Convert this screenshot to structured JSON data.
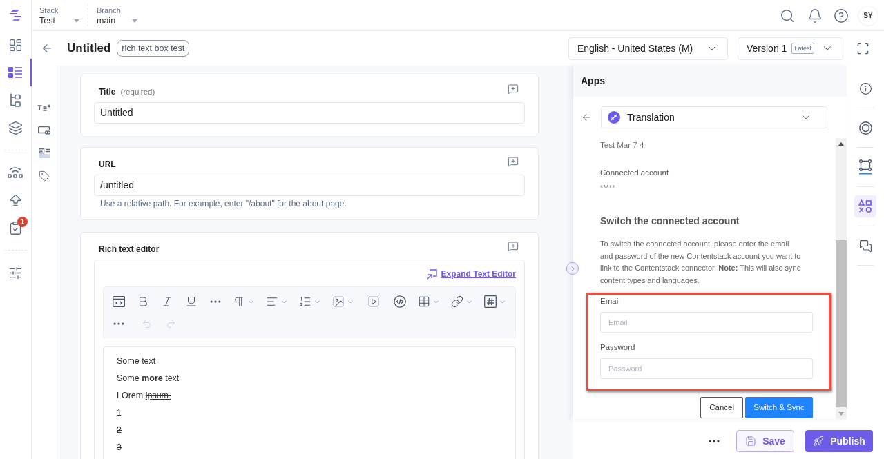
{
  "header": {
    "stack": {
      "label": "Stack",
      "value": "Test"
    },
    "branch": {
      "label": "Branch",
      "value": "main"
    },
    "avatar": "SY"
  },
  "nav_rail": {
    "items": [
      {
        "selected": false
      },
      {
        "selected": true
      },
      {
        "selected": false
      },
      {
        "selected": false
      },
      {
        "selected": false
      },
      {
        "selected": false
      },
      {
        "selected": false,
        "badge": "1"
      },
      {
        "selected": false
      }
    ]
  },
  "entry_bar": {
    "title": "Untitled",
    "tag": "rich text box test",
    "locale": "English - United States (M)",
    "version": "Version 1",
    "version_badge": "Latest"
  },
  "fields": [
    {
      "kind": "text",
      "label": "Title",
      "note": "(required)",
      "value": "Untitled"
    },
    {
      "kind": "text",
      "label": "URL",
      "value": "/untitled",
      "help": "Use a relative path. For example, enter \"/about\" for the about page."
    },
    {
      "kind": "rich_text",
      "label": "Rich text editor",
      "expand_link": "Expand Text Editor",
      "toolbar": {
        "undo_disabled": true,
        "redo_disabled": true
      },
      "paragraphs": [
        {
          "runs": [
            {
              "text": "Some text",
              "strike": false,
              "underline": false
            }
          ]
        },
        {
          "runs": [
            {
              "text": "Some **more** text",
              "strike": false,
              "underline": false
            }
          ]
        },
        {
          "runs": [
            {
              "text": "LOrem ",
              "strike": false,
              "underline": false
            },
            {
              "text": "ipsum ",
              "strike": true,
              "underline": true
            }
          ]
        },
        {
          "runs": [
            {
              "text": "1",
              "strike": true,
              "underline": false
            }
          ]
        },
        {
          "runs": [
            {
              "text": "2",
              "strike": true,
              "underline": false
            }
          ]
        },
        {
          "runs": [
            {
              "text": "3",
              "strike": true,
              "underline": false
            }
          ]
        }
      ]
    }
  ],
  "apps_panel": {
    "title": "Apps",
    "app": "Translation",
    "account_name": "Test Mar 7 4",
    "connected_label": "Connected account",
    "connected_value": "*****",
    "heading": "Switch the connected account",
    "description": "To switch the connected account, please enter the email and password of the new Contentstack account you want to link to the Contentstack connector. **Note:** This will also sync content types and languages.",
    "credentials": {
      "highlighted": true,
      "fields": [
        {
          "label": "Email",
          "placeholder": "Email"
        },
        {
          "label": "Password",
          "placeholder": "Password"
        }
      ]
    },
    "buttons": [
      {
        "kind": "secondary",
        "label": "Cancel"
      },
      {
        "kind": "primary",
        "label": "Switch & Sync"
      }
    ]
  },
  "right_rail": {
    "items": [
      {
        "selected": false
      },
      {
        "selected": false
      },
      {
        "selected": false
      },
      {
        "selected": true
      },
      {
        "selected": false
      }
    ]
  },
  "actions": {
    "save": "Save",
    "publish": "Publish"
  }
}
